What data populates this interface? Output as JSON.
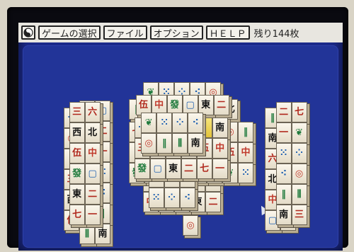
{
  "menu": {
    "game_select": "ゲームの選択",
    "file": "ファイル",
    "options": "オプション",
    "help": "ＨＥＬＰ",
    "remaining": "残り144枚"
  },
  "tiles": [
    {
      "n": "tile-p5",
      "t": "⁘",
      "c": "#1d5fb0"
    },
    {
      "n": "tile-p3",
      "t": "⁖",
      "c": "#1d5fb0"
    },
    {
      "n": "tile-p1",
      "t": "◎",
      "c": "#c0392b"
    },
    {
      "n": "tile-s2",
      "t": "‖",
      "c": "#1f7a3c"
    },
    {
      "n": "tile-s9",
      "t": "⫼",
      "c": "#1f7a3c"
    },
    {
      "n": "tile-south",
      "t": "南",
      "c": "#111"
    },
    {
      "n": "tile-m3",
      "t": "三",
      "c": "#b0271c"
    },
    {
      "n": "tile-m6",
      "t": "六",
      "c": "#b0271c"
    },
    {
      "n": "tile-west",
      "t": "西",
      "c": "#111"
    },
    {
      "n": "tile-north",
      "t": "北",
      "c": "#111"
    },
    {
      "n": "tile-m5",
      "t": "伍",
      "c": "#b0271c"
    },
    {
      "n": "tile-red",
      "t": "中",
      "c": "#c0392b"
    },
    {
      "n": "tile-green",
      "t": "發",
      "c": "#1f7a3c"
    },
    {
      "n": "tile-white",
      "t": "▢",
      "c": "#1d5fb0"
    },
    {
      "n": "tile-east",
      "t": "東",
      "c": "#111"
    },
    {
      "n": "tile-m2",
      "t": "二",
      "c": "#b0271c"
    },
    {
      "n": "tile-m7",
      "t": "七",
      "c": "#b0271c"
    },
    {
      "n": "tile-m1",
      "t": "一",
      "c": "#b0271c"
    },
    {
      "n": "tile-s1",
      "t": "❦",
      "c": "#1f7a3c"
    },
    {
      "n": "tile-p9",
      "t": "⁙",
      "c": "#1d5fb0"
    }
  ]
}
